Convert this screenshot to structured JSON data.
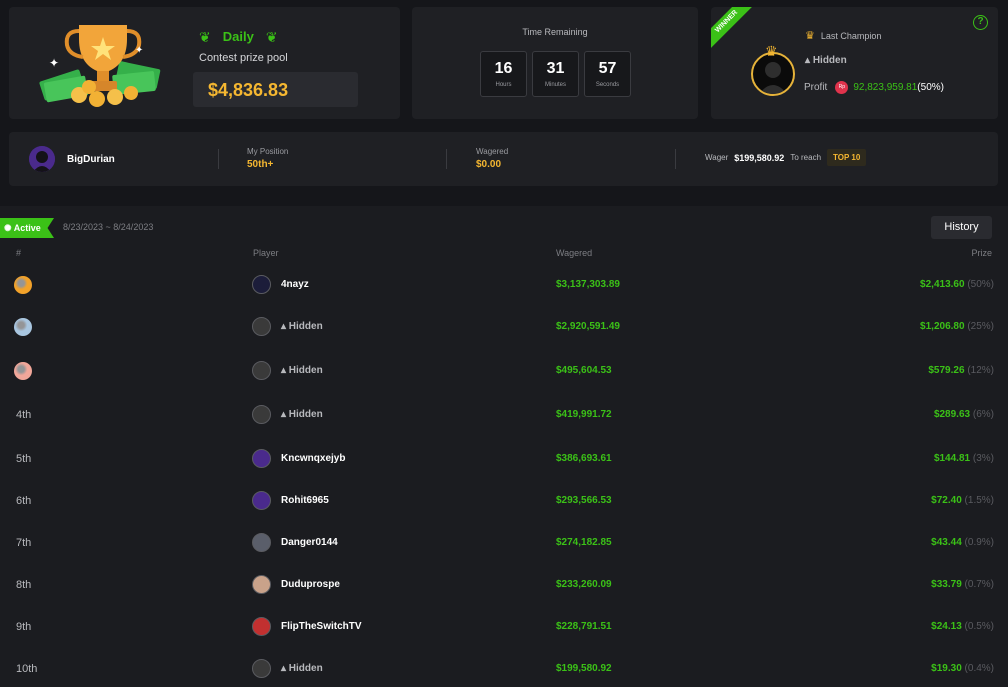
{
  "prize": {
    "badge": "Daily",
    "label": "Contest prize pool",
    "value": "$4,836.83"
  },
  "timer": {
    "label": "Time Remaining",
    "hours": "16",
    "hours_unit": "Hours",
    "minutes": "31",
    "minutes_unit": "Minutes",
    "seconds": "57",
    "seconds_unit": "Seconds"
  },
  "champion": {
    "ribbon": "WINNER",
    "title": "Last Champion",
    "name": "Hidden",
    "profit_label": "Profit",
    "currency": "Rp",
    "profit_value": "92,823,959.81",
    "profit_pct": "(50%)"
  },
  "me": {
    "username": "BigDurian",
    "position_label": "My Position",
    "position_value": "50th+",
    "wagered_label": "Wagered",
    "wagered_value": "$0.00",
    "wager_label": "Wager",
    "wager_amount": "$199,580.92",
    "to_reach_label": "To reach",
    "target": "TOP 10"
  },
  "board": {
    "status": "Active",
    "date_range": "8/23/2023 ~ 8/24/2023",
    "history_label": "History",
    "col_rank": "#",
    "col_player": "Player",
    "col_wagered": "Wagered",
    "col_prize": "Prize",
    "rows": [
      {
        "rank": "",
        "medal": "gold-medal-icon",
        "name": "4nayz",
        "hidden": false,
        "wagered": "$3,137,303.89",
        "prize": "$2,413.60",
        "pct": "(50%)"
      },
      {
        "rank": "",
        "medal": "silver-medal-icon",
        "name": "Hidden",
        "hidden": true,
        "wagered": "$2,920,591.49",
        "prize": "$1,206.80",
        "pct": "(25%)"
      },
      {
        "rank": "",
        "medal": "bronze-medal-icon",
        "name": "Hidden",
        "hidden": true,
        "wagered": "$495,604.53",
        "prize": "$579.26",
        "pct": "(12%)"
      },
      {
        "rank": "4th",
        "medal": "",
        "name": "Hidden",
        "hidden": true,
        "wagered": "$419,991.72",
        "prize": "$289.63",
        "pct": "(6%)"
      },
      {
        "rank": "5th",
        "medal": "",
        "name": "Kncwnqxejyb",
        "hidden": false,
        "wagered": "$386,693.61",
        "prize": "$144.81",
        "pct": "(3%)"
      },
      {
        "rank": "6th",
        "medal": "",
        "name": "Rohit6965",
        "hidden": false,
        "wagered": "$293,566.53",
        "prize": "$72.40",
        "pct": "(1.5%)"
      },
      {
        "rank": "7th",
        "medal": "",
        "name": "Danger0144",
        "hidden": false,
        "wagered": "$274,182.85",
        "prize": "$43.44",
        "pct": "(0.9%)"
      },
      {
        "rank": "8th",
        "medal": "",
        "name": "Duduprospe",
        "hidden": false,
        "wagered": "$233,260.09",
        "prize": "$33.79",
        "pct": "(0.7%)"
      },
      {
        "rank": "9th",
        "medal": "",
        "name": "FlipTheSwitchTV",
        "hidden": false,
        "wagered": "$228,791.51",
        "prize": "$24.13",
        "pct": "(0.5%)"
      },
      {
        "rank": "10th",
        "medal": "",
        "name": "Hidden",
        "hidden": true,
        "wagered": "$199,580.92",
        "prize": "$19.30",
        "pct": "(0.4%)"
      }
    ]
  }
}
